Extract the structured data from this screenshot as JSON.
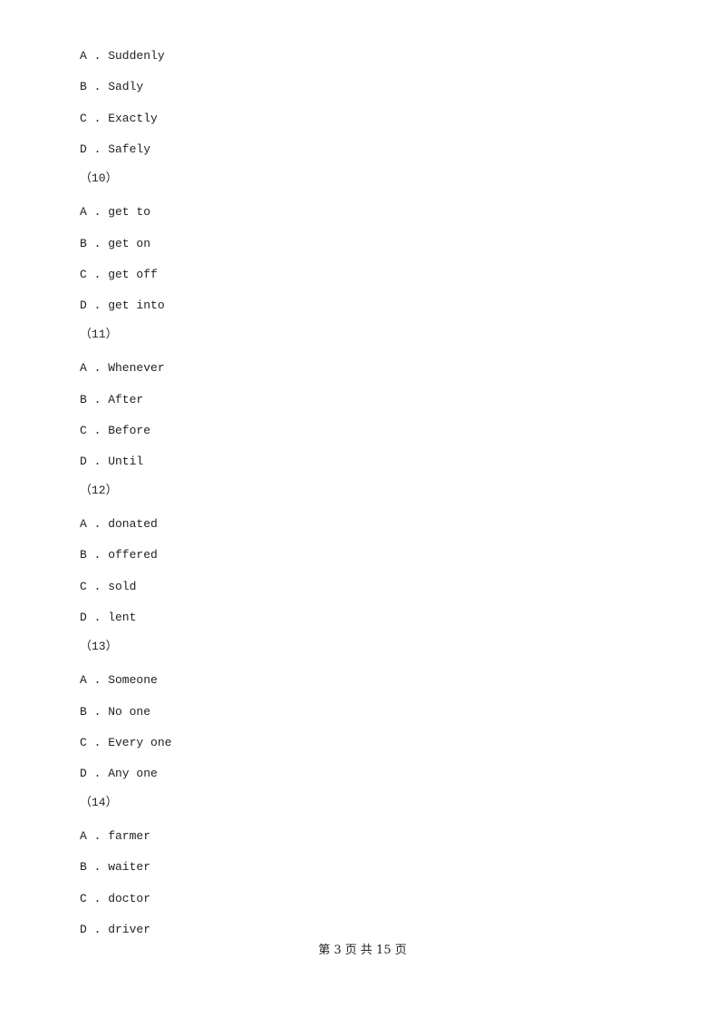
{
  "items": [
    {
      "type": "option",
      "letter": "A",
      "text": "Suddenly"
    },
    {
      "type": "option",
      "letter": "B",
      "text": "Sadly"
    },
    {
      "type": "option",
      "letter": "C",
      "text": "Exactly"
    },
    {
      "type": "option",
      "letter": "D",
      "text": "Safely"
    },
    {
      "type": "question",
      "text": "（10）"
    },
    {
      "type": "option",
      "letter": "A",
      "text": "get to"
    },
    {
      "type": "option",
      "letter": "B",
      "text": "get on"
    },
    {
      "type": "option",
      "letter": "C",
      "text": "get off"
    },
    {
      "type": "option",
      "letter": "D",
      "text": "get into"
    },
    {
      "type": "question",
      "text": "（11）"
    },
    {
      "type": "option",
      "letter": "A",
      "text": "Whenever"
    },
    {
      "type": "option",
      "letter": "B",
      "text": "After"
    },
    {
      "type": "option",
      "letter": "C",
      "text": "Before"
    },
    {
      "type": "option",
      "letter": "D",
      "text": "Until"
    },
    {
      "type": "question",
      "text": "（12）"
    },
    {
      "type": "option",
      "letter": "A",
      "text": "donated"
    },
    {
      "type": "option",
      "letter": "B",
      "text": "offered"
    },
    {
      "type": "option",
      "letter": "C",
      "text": "sold"
    },
    {
      "type": "option",
      "letter": "D",
      "text": "lent"
    },
    {
      "type": "question",
      "text": "（13）"
    },
    {
      "type": "option",
      "letter": "A",
      "text": "Someone"
    },
    {
      "type": "option",
      "letter": "B",
      "text": "No one"
    },
    {
      "type": "option",
      "letter": "C",
      "text": "Every one"
    },
    {
      "type": "option",
      "letter": "D",
      "text": "Any one"
    },
    {
      "type": "question",
      "text": "（14）"
    },
    {
      "type": "option",
      "letter": "A",
      "text": "farmer"
    },
    {
      "type": "option",
      "letter": "B",
      "text": "waiter"
    },
    {
      "type": "option",
      "letter": "C",
      "text": "doctor"
    },
    {
      "type": "option",
      "letter": "D",
      "text": "driver"
    }
  ],
  "footer": {
    "text": "第 3 页 共 15 页"
  }
}
